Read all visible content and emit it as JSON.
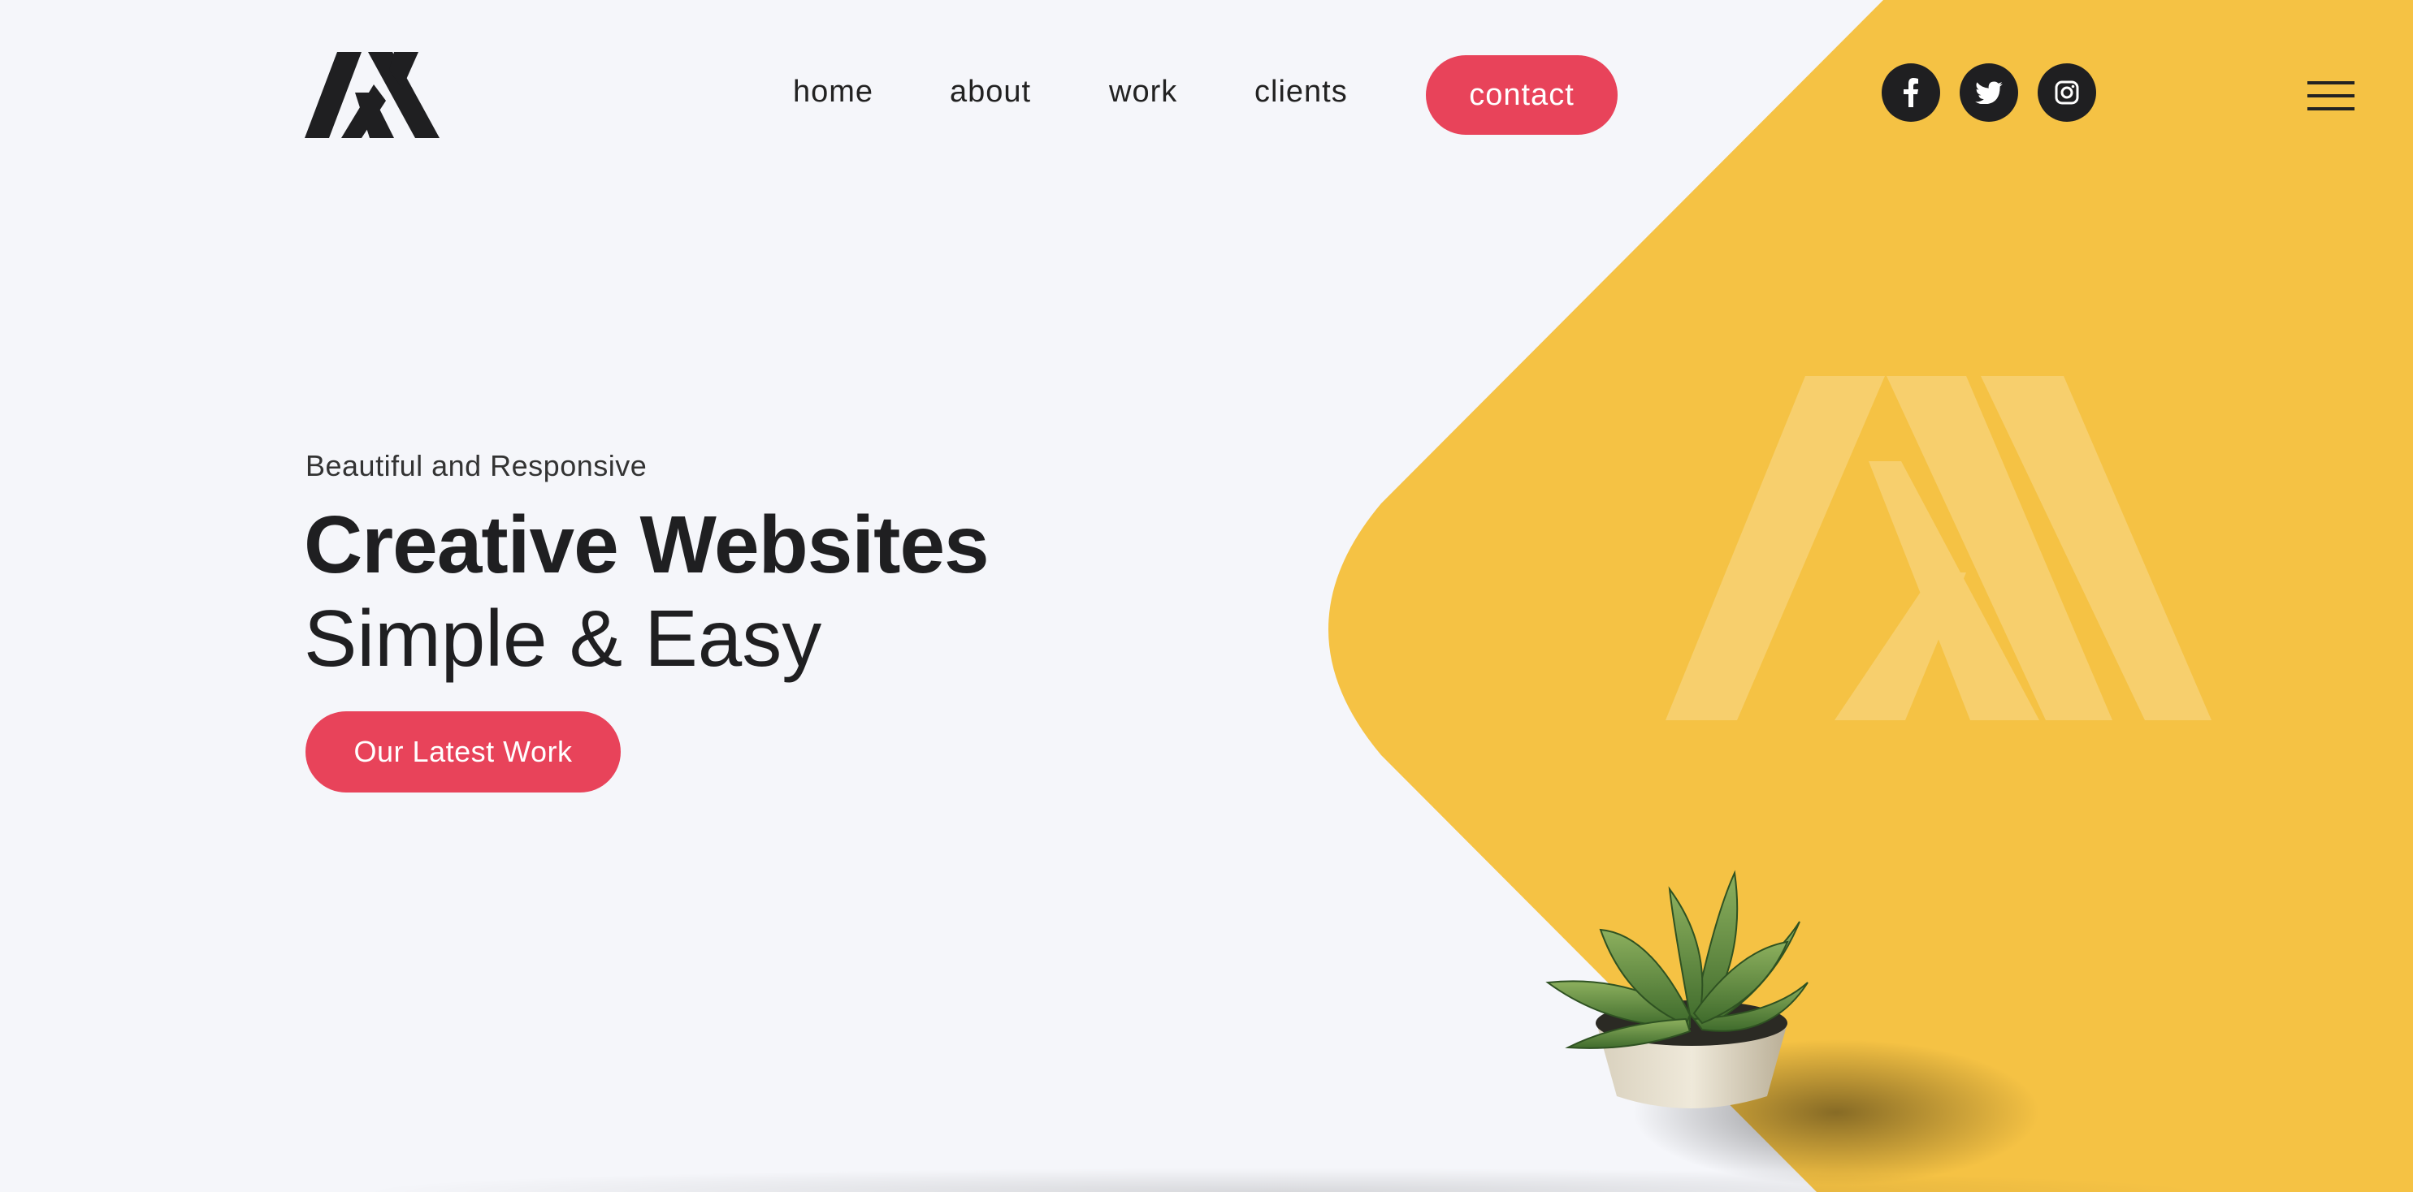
{
  "nav": {
    "links": [
      "home",
      "about",
      "work",
      "clients"
    ],
    "contact_label": "contact"
  },
  "social": [
    "facebook-icon",
    "twitter-icon",
    "instagram-icon"
  ],
  "hero": {
    "eyebrow": "Beautiful and Responsive",
    "title": "Creative Websites",
    "subtitle": "Simple & Easy",
    "cta_label": "Our Latest Work"
  },
  "colors": {
    "background": "#f5f6fa",
    "accent_red": "#e8435a",
    "accent_yellow": "#f5c244",
    "dark": "#1f1f21"
  }
}
